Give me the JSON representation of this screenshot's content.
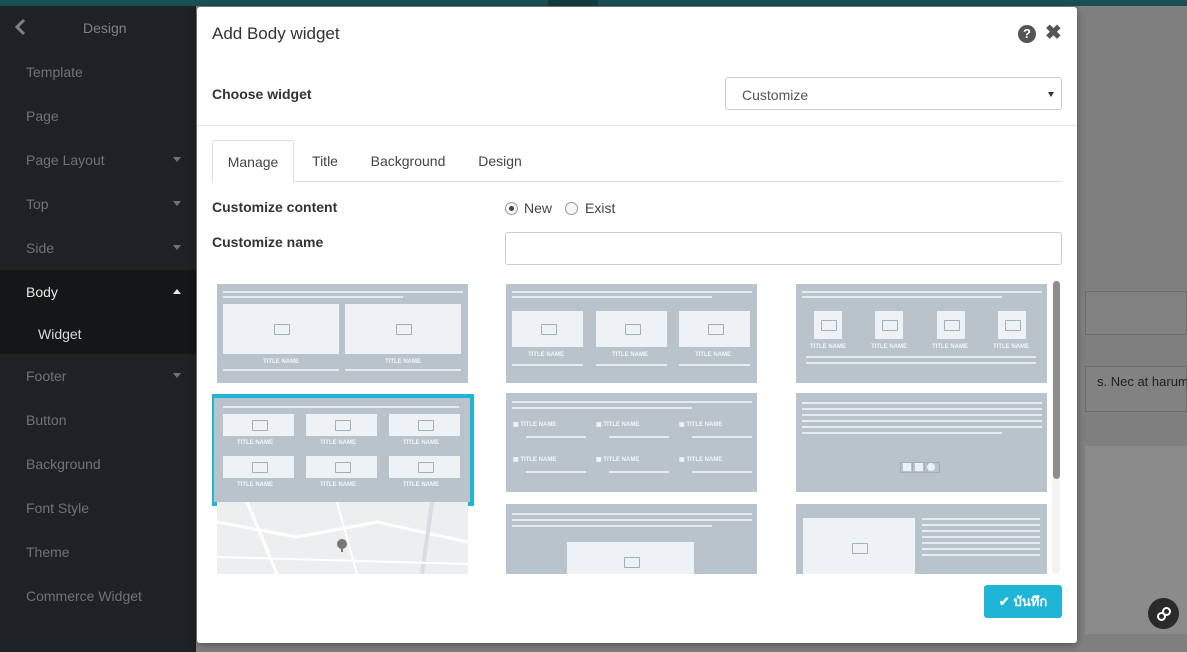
{
  "sidebar": {
    "header": "Design",
    "items": [
      {
        "label": "Template"
      },
      {
        "label": "Page"
      },
      {
        "label": "Page Layout"
      },
      {
        "label": "Top"
      },
      {
        "label": "Side"
      },
      {
        "label": "Body"
      },
      {
        "label": "Footer"
      },
      {
        "label": "Button"
      },
      {
        "label": "Background"
      },
      {
        "label": "Font Style"
      },
      {
        "label": "Theme"
      },
      {
        "label": "Commerce Widget"
      }
    ],
    "sub_item": "Widget"
  },
  "background_page": {
    "text": "s. Nec at harum"
  },
  "modal": {
    "title": "Add Body widget",
    "choose_label": "Choose widget",
    "choose_value": "Customize",
    "tabs": [
      "Manage",
      "Title",
      "Background",
      "Design"
    ],
    "customize_content_label": "Customize content",
    "radio_new": "New",
    "radio_exist": "Exist",
    "customize_name_label": "Customize name",
    "customize_name_value": "",
    "save_label": "บันทึก"
  },
  "widget_text": {
    "title_name": "TITLE NAME"
  },
  "colors": {
    "accent": "#1fb5d6",
    "sidebar_bg": "#1f2224",
    "thumb_bg": "#b9c3cc"
  },
  "icons": {
    "help": "question-circle-icon",
    "close": "close-icon",
    "save": "check-icon",
    "back": "chevron-left-icon"
  }
}
